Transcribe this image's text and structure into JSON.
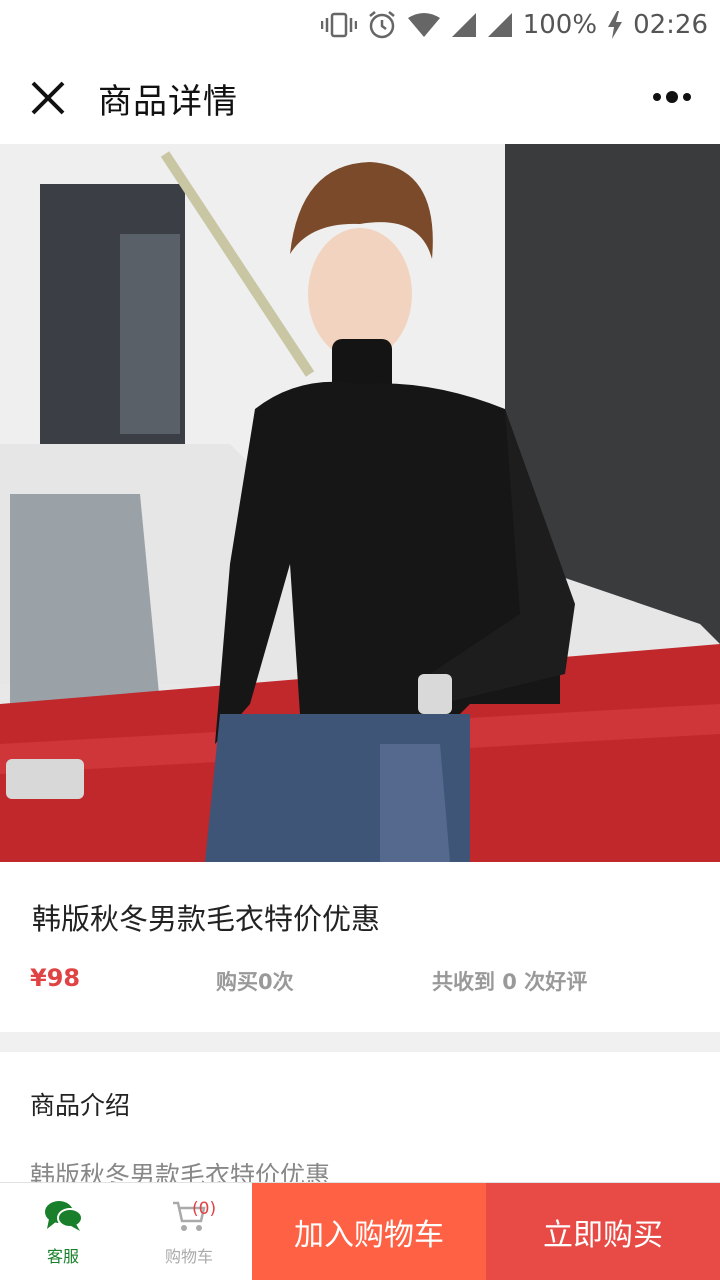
{
  "status_bar": {
    "battery": "100%",
    "time": "02:26",
    "icons": [
      "vibrate-icon",
      "alarm-icon",
      "wifi-icon",
      "signal-icon",
      "signal-icon",
      "charging-icon"
    ]
  },
  "nav": {
    "title": "商品详情",
    "close_icon": "close-icon",
    "more_icon": "more-icon"
  },
  "product": {
    "image": "product-photo",
    "title": "韩版秋冬男款毛衣特价优惠",
    "price": "¥98",
    "bought": "购买0次",
    "reviews": "共收到 0 次好评"
  },
  "intro": {
    "heading": "商品介绍",
    "body": "韩版秋冬男款毛衣特价优惠"
  },
  "bottom_bar": {
    "customer_service": "客服",
    "cart_label": "购物车",
    "cart_count": "(0)",
    "add_to_cart": "加入购物车",
    "buy_now": "立即购买"
  },
  "colors": {
    "price": "#e04343",
    "add_to_cart": "#ff6145",
    "buy_now": "#e84a45",
    "service_green": "#1a7f2a"
  }
}
